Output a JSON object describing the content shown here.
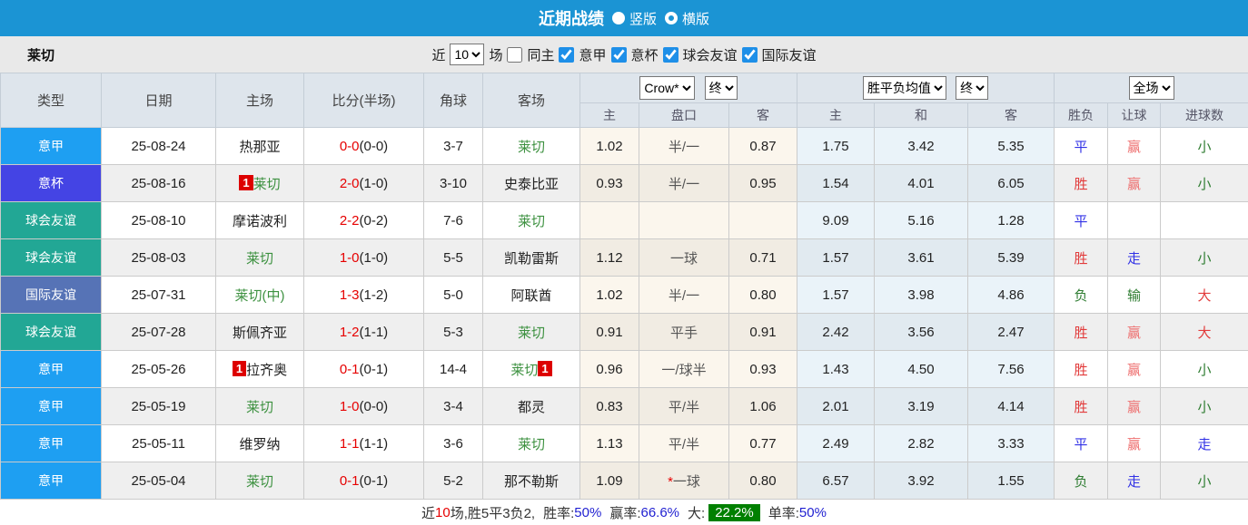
{
  "title_bar": {
    "title": "近期战绩",
    "radio_vertical_label": "竖版",
    "radio_horizontal_label": "横版",
    "selected_layout": "横版"
  },
  "filter_bar": {
    "team": "莱切",
    "near_label": "近",
    "match_count": "10",
    "games_label": "场",
    "match_count_checked": false,
    "same_home_label": "同主",
    "leagues": [
      {
        "label": "意甲",
        "checked": true
      },
      {
        "label": "意杯",
        "checked": true
      },
      {
        "label": "球会友谊",
        "checked": true
      },
      {
        "label": "国际友谊",
        "checked": true
      }
    ]
  },
  "table": {
    "columns": [
      "类型",
      "日期",
      "主场",
      "比分(半场)",
      "角球",
      "客场"
    ],
    "sub_columns": [
      "主",
      "盘口",
      "客",
      "主",
      "和",
      "客",
      "胜负",
      "让球",
      "进球数"
    ],
    "selects": {
      "bookmaker": "Crow*",
      "bookmaker_time": "终",
      "europe_type": "胜平负均值",
      "europe_time": "终",
      "scope": "全场"
    },
    "rows": [
      {
        "type": "意甲",
        "type_color": "serie-a",
        "date": "25-08-24",
        "home": {
          "name": "热那亚",
          "green": false
        },
        "score_ft": "0-0",
        "score_ht": "(0-0)",
        "corners": "3-7",
        "away": {
          "name": "莱切",
          "green": true
        },
        "ah_home": "1.02",
        "ah_line": "半/一",
        "ah_star": false,
        "ah_away": "0.87",
        "odds_home": "1.75",
        "odds_draw": "3.42",
        "odds_away": "5.35",
        "result": {
          "text": "平",
          "color": "blue"
        },
        "ah_result": {
          "text": "赢",
          "color": "red2"
        },
        "goals_result": {
          "text": "小",
          "color": "green"
        }
      },
      {
        "type": "意杯",
        "type_color": "cup",
        "date": "25-08-16",
        "home": {
          "name": "莱切",
          "green": true,
          "badge_before": "1"
        },
        "score_ft": "2-0",
        "score_ht": "(1-0)",
        "corners": "3-10",
        "away": {
          "name": "史泰比亚",
          "green": false
        },
        "ah_home": "0.93",
        "ah_line": "半/一",
        "ah_star": false,
        "ah_away": "0.95",
        "odds_home": "1.54",
        "odds_draw": "4.01",
        "odds_away": "6.05",
        "result": {
          "text": "胜",
          "color": "red"
        },
        "ah_result": {
          "text": "赢",
          "color": "red2"
        },
        "goals_result": {
          "text": "小",
          "color": "green"
        }
      },
      {
        "type": "球会友谊",
        "type_color": "club",
        "date": "25-08-10",
        "home": {
          "name": "摩诺波利",
          "green": false
        },
        "score_ft": "2-2",
        "score_ht": "(0-2)",
        "corners": "7-6",
        "away": {
          "name": "莱切",
          "green": true
        },
        "ah_home": "",
        "ah_line": "",
        "ah_star": false,
        "ah_away": "",
        "odds_home": "9.09",
        "odds_draw": "5.16",
        "odds_away": "1.28",
        "result": {
          "text": "平",
          "color": "blue"
        },
        "ah_result": {
          "text": "",
          "color": ""
        },
        "goals_result": {
          "text": "",
          "color": ""
        }
      },
      {
        "type": "球会友谊",
        "type_color": "club",
        "date": "25-08-03",
        "home": {
          "name": "莱切",
          "green": true
        },
        "score_ft": "1-0",
        "score_ht": "(1-0)",
        "corners": "5-5",
        "away": {
          "name": "凯勒雷斯",
          "green": false
        },
        "ah_home": "1.12",
        "ah_line": "一球",
        "ah_star": false,
        "ah_away": "0.71",
        "odds_home": "1.57",
        "odds_draw": "3.61",
        "odds_away": "5.39",
        "result": {
          "text": "胜",
          "color": "red"
        },
        "ah_result": {
          "text": "走",
          "color": "blue"
        },
        "goals_result": {
          "text": "小",
          "color": "green"
        }
      },
      {
        "type": "国际友谊",
        "type_color": "intl",
        "date": "25-07-31",
        "home": {
          "name": "莱切(中)",
          "green": true
        },
        "score_ft": "1-3",
        "score_ht": "(1-2)",
        "corners": "5-0",
        "away": {
          "name": "阿联酋",
          "green": false
        },
        "ah_home": "1.02",
        "ah_line": "半/一",
        "ah_star": false,
        "ah_away": "0.80",
        "odds_home": "1.57",
        "odds_draw": "3.98",
        "odds_away": "4.86",
        "result": {
          "text": "负",
          "color": "green"
        },
        "ah_result": {
          "text": "输",
          "color": "green"
        },
        "goals_result": {
          "text": "大",
          "color": "red"
        }
      },
      {
        "type": "球会友谊",
        "type_color": "club",
        "date": "25-07-28",
        "home": {
          "name": "斯佩齐亚",
          "green": false
        },
        "score_ft": "1-2",
        "score_ht": "(1-1)",
        "corners": "5-3",
        "away": {
          "name": "莱切",
          "green": true
        },
        "ah_home": "0.91",
        "ah_line": "平手",
        "ah_star": false,
        "ah_away": "0.91",
        "odds_home": "2.42",
        "odds_draw": "3.56",
        "odds_away": "2.47",
        "result": {
          "text": "胜",
          "color": "red"
        },
        "ah_result": {
          "text": "赢",
          "color": "red2"
        },
        "goals_result": {
          "text": "大",
          "color": "red"
        }
      },
      {
        "type": "意甲",
        "type_color": "serie-a",
        "date": "25-05-26",
        "home": {
          "name": "拉齐奥",
          "green": false,
          "badge_before": "1"
        },
        "score_ft": "0-1",
        "score_ht": "(0-1)",
        "corners": "14-4",
        "away": {
          "name": "莱切",
          "green": true,
          "badge_after": "1"
        },
        "ah_home": "0.96",
        "ah_line": "一/球半",
        "ah_star": false,
        "ah_away": "0.93",
        "odds_home": "1.43",
        "odds_draw": "4.50",
        "odds_away": "7.56",
        "result": {
          "text": "胜",
          "color": "red"
        },
        "ah_result": {
          "text": "赢",
          "color": "red2"
        },
        "goals_result": {
          "text": "小",
          "color": "green"
        }
      },
      {
        "type": "意甲",
        "type_color": "serie-a",
        "date": "25-05-19",
        "home": {
          "name": "莱切",
          "green": true
        },
        "score_ft": "1-0",
        "score_ht": "(0-0)",
        "corners": "3-4",
        "away": {
          "name": "都灵",
          "green": false
        },
        "ah_home": "0.83",
        "ah_line": "平/半",
        "ah_star": false,
        "ah_away": "1.06",
        "odds_home": "2.01",
        "odds_draw": "3.19",
        "odds_away": "4.14",
        "result": {
          "text": "胜",
          "color": "red"
        },
        "ah_result": {
          "text": "赢",
          "color": "red2"
        },
        "goals_result": {
          "text": "小",
          "color": "green"
        }
      },
      {
        "type": "意甲",
        "type_color": "serie-a",
        "date": "25-05-11",
        "home": {
          "name": "维罗纳",
          "green": false
        },
        "score_ft": "1-1",
        "score_ht": "(1-1)",
        "corners": "3-6",
        "away": {
          "name": "莱切",
          "green": true
        },
        "ah_home": "1.13",
        "ah_line": "平/半",
        "ah_star": false,
        "ah_away": "0.77",
        "odds_home": "2.49",
        "odds_draw": "2.82",
        "odds_away": "3.33",
        "result": {
          "text": "平",
          "color": "blue"
        },
        "ah_result": {
          "text": "赢",
          "color": "red2"
        },
        "goals_result": {
          "text": "走",
          "color": "blue"
        }
      },
      {
        "type": "意甲",
        "type_color": "serie-a",
        "date": "25-05-04",
        "home": {
          "name": "莱切",
          "green": true
        },
        "score_ft": "0-1",
        "score_ht": "(0-1)",
        "corners": "5-2",
        "away": {
          "name": "那不勒斯",
          "green": false
        },
        "ah_home": "1.09",
        "ah_line": "一球",
        "ah_star": true,
        "ah_away": "0.80",
        "odds_home": "6.57",
        "odds_draw": "3.92",
        "odds_away": "1.55",
        "result": {
          "text": "负",
          "color": "green"
        },
        "ah_result": {
          "text": "走",
          "color": "blue"
        },
        "goals_result": {
          "text": "小",
          "color": "green"
        }
      }
    ]
  },
  "summary": {
    "prefix": "近",
    "count": "10",
    "mid": "场,胜5平3负2,",
    "win_rate_label": "胜率:",
    "win_rate": "50%",
    "ah_rate_label": "赢率:",
    "ah_rate": "66.6%",
    "big_label": "大:",
    "big_rate": "22.2%",
    "single_label": "单率:",
    "single_rate": "50%"
  },
  "colors": {
    "topbar": "#1b94d4",
    "serie_a_badge": "#1e9ff2",
    "cup_badge": "#4444e4",
    "club_friendly_badge": "#22a795",
    "intl_friendly_badge": "#5673b6",
    "score_red": "#e60000",
    "team_green": "#3d9140",
    "summary_green_bg": "#008000"
  }
}
